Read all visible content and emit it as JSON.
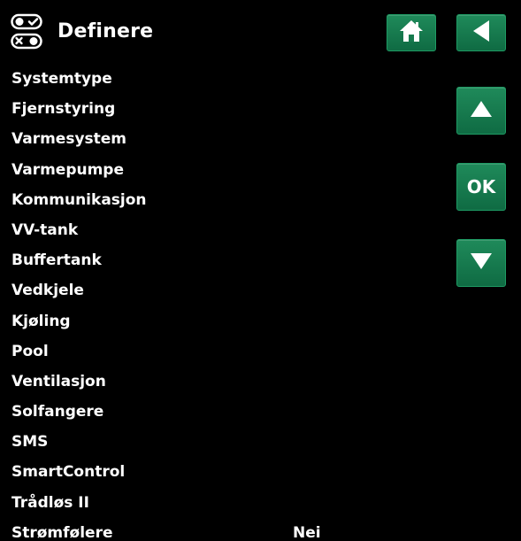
{
  "header": {
    "title": "Definere",
    "icon": "toggle-switches-icon"
  },
  "buttons": {
    "home_icon": "home-icon",
    "back_icon": "back-arrow-icon",
    "up_icon": "arrow-up-icon",
    "ok_label": "OK",
    "down_icon": "arrow-down-icon"
  },
  "menu": {
    "items": [
      {
        "label": "Systemtype"
      },
      {
        "label": "Fjernstyring"
      },
      {
        "label": "Varmesystem"
      },
      {
        "label": "Varmepumpe"
      },
      {
        "label": "Kommunikasjon"
      },
      {
        "label": "VV-tank"
      },
      {
        "label": "Buffertank"
      },
      {
        "label": "Vedkjele"
      },
      {
        "label": "Kjøling"
      },
      {
        "label": "Pool"
      },
      {
        "label": "Ventilasjon"
      },
      {
        "label": "Solfangere"
      },
      {
        "label": "SMS"
      },
      {
        "label": "SmartControl"
      },
      {
        "label": "Trådløs II"
      },
      {
        "label": "Strømfølere",
        "value": "Nei"
      }
    ]
  },
  "colors": {
    "background": "#000000",
    "button_green": "#167a4e",
    "text": "#ffffff"
  }
}
